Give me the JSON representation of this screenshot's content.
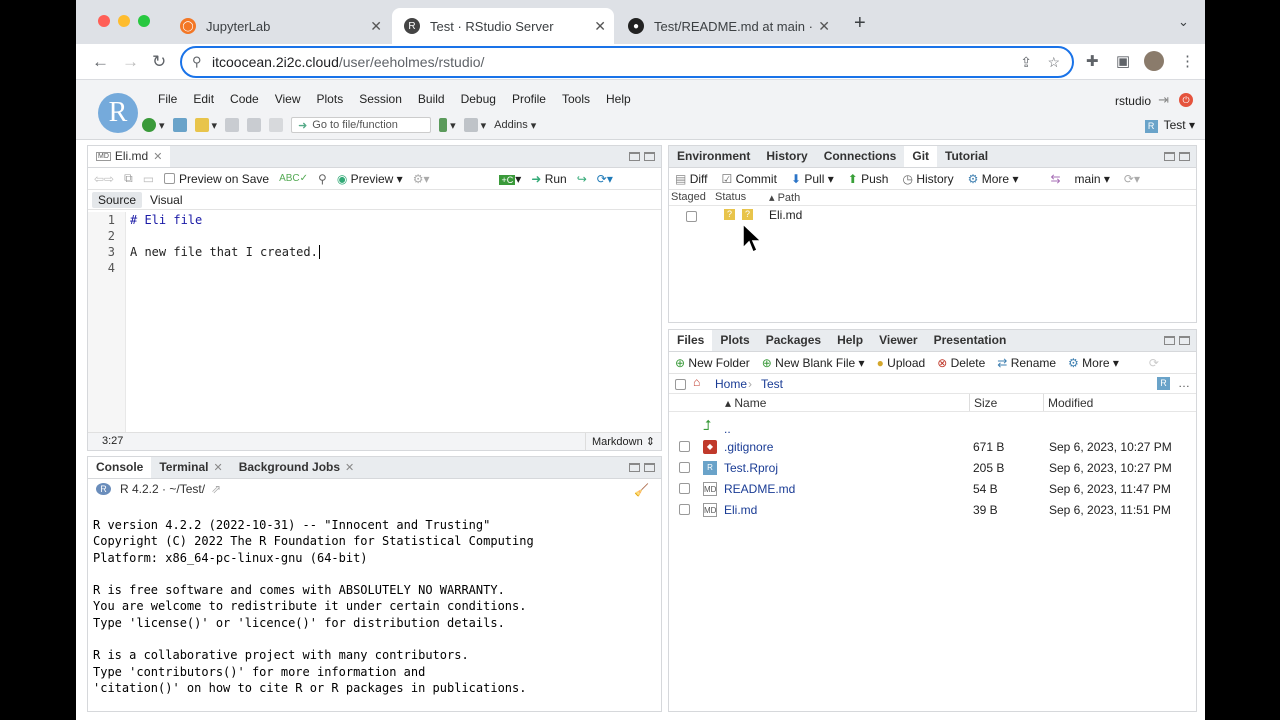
{
  "browser": {
    "tabs": [
      {
        "label": "JupyterLab",
        "active": false
      },
      {
        "label": "Test · RStudio Server",
        "active": true
      },
      {
        "label": "Test/README.md at main · eeh",
        "active": false
      }
    ],
    "new_tab": "+",
    "url_host": "itcoocean.2i2c.cloud",
    "url_path": "/user/eeholmes/rstudio/"
  },
  "rstudio": {
    "logo": "R",
    "menus": [
      "File",
      "Edit",
      "Code",
      "View",
      "Plots",
      "Session",
      "Build",
      "Debug",
      "Profile",
      "Tools",
      "Help"
    ],
    "user": "rstudio",
    "goto_placeholder": "Go to file/function",
    "addins": "Addins",
    "project": "Test"
  },
  "editor": {
    "tab": "Eli.md",
    "tab_badge": "MD",
    "preview_on_save": "Preview on Save",
    "preview": "Preview",
    "run": "Run",
    "mode_source": "Source",
    "mode_visual": "Visual",
    "lines": [
      "# Eli file",
      "",
      "A new file that I created.",
      ""
    ],
    "line_numbers": [
      "1",
      "2",
      "3",
      "4"
    ],
    "cursor_pos": "3:27",
    "file_type": "Markdown"
  },
  "console": {
    "tabs": [
      "Console",
      "Terminal",
      "Background Jobs"
    ],
    "r_version": "R 4.2.2",
    "path": "~/Test/",
    "lines": [
      "R version 4.2.2 (2022-10-31) -- \"Innocent and Trusting\"",
      "Copyright (C) 2022 The R Foundation for Statistical Computing",
      "Platform: x86_64-pc-linux-gnu (64-bit)",
      "",
      "R is free software and comes with ABSOLUTELY NO WARRANTY.",
      "You are welcome to redistribute it under certain conditions.",
      "Type 'license()' or 'licence()' for distribution details.",
      "",
      "R is a collaborative project with many contributors.",
      "Type 'contributors()' for more information and",
      "'citation()' on how to cite R or R packages in publications."
    ]
  },
  "git_pane": {
    "tabs": [
      "Environment",
      "History",
      "Connections",
      "Git",
      "Tutorial"
    ],
    "selected_tab": "Git",
    "toolbar": {
      "diff": "Diff",
      "commit": "Commit",
      "pull": "Pull",
      "push": "Push",
      "history": "History",
      "more": "More",
      "branch": "main"
    },
    "columns": {
      "staged": "Staged",
      "status": "Status",
      "path": "Path"
    },
    "rows": [
      {
        "path": "Eli.md",
        "status": "?"
      }
    ]
  },
  "files_pane": {
    "tabs": [
      "Files",
      "Plots",
      "Packages",
      "Help",
      "Viewer",
      "Presentation"
    ],
    "toolbar": {
      "new_folder": "New Folder",
      "new_blank_file": "New Blank File",
      "upload": "Upload",
      "delete": "Delete",
      "rename": "Rename",
      "more": "More"
    },
    "breadcrumb": {
      "home": "Home",
      "folder": "Test"
    },
    "columns": {
      "name": "Name",
      "size": "Size",
      "modified": "Modified"
    },
    "up": "..",
    "files": [
      {
        "name": ".gitignore",
        "size": "671 B",
        "modified": "Sep 6, 2023, 10:27 PM"
      },
      {
        "name": "Test.Rproj",
        "size": "205 B",
        "modified": "Sep 6, 2023, 10:27 PM"
      },
      {
        "name": "README.md",
        "size": "54 B",
        "modified": "Sep 6, 2023, 11:47 PM"
      },
      {
        "name": "Eli.md",
        "size": "39 B",
        "modified": "Sep 6, 2023, 11:51 PM"
      }
    ]
  }
}
